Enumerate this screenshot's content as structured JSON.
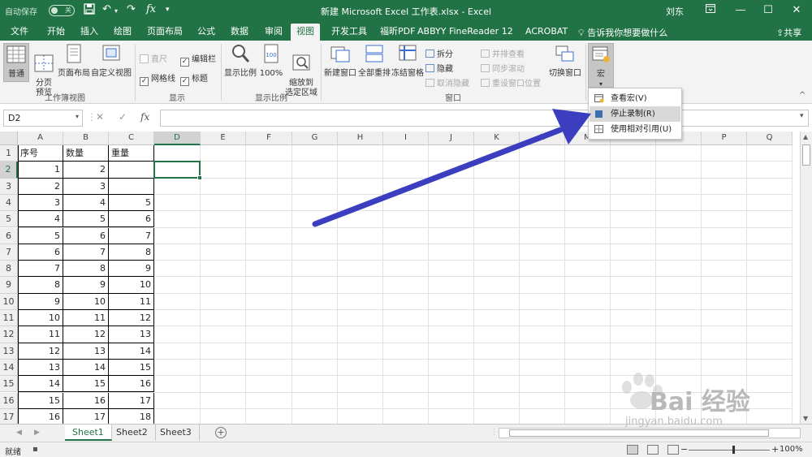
{
  "titlebar": {
    "autosave_label": "自动保存",
    "autosave_state": "关",
    "title": "新建 Microsoft Excel 工作表.xlsx  -  Excel",
    "user": "刘东",
    "undo_icon": "↶",
    "redo_icon": "↷",
    "fx_icon": "fx"
  },
  "tabs": [
    "文件",
    "开始",
    "插入",
    "绘图",
    "页面布局",
    "公式",
    "数据",
    "审阅",
    "视图",
    "开发工具",
    "福昕PDF",
    "ABBYY FineReader 12",
    "ACROBAT"
  ],
  "active_tab": "视图",
  "tellme": "告诉我你想要做什么",
  "share": "共享",
  "ribbon": {
    "group1": {
      "label": "工作簿视图",
      "normal": "普通",
      "pagebreak": "分页\n预览",
      "pagelayout": "页面布局",
      "custom": "自定义视图"
    },
    "group2": {
      "label": "显示",
      "ruler": "直尺",
      "formula_bar": "编辑栏",
      "gridlines": "网格线",
      "headings": "标题"
    },
    "group3": {
      "label": "显示比例",
      "zoom": "显示比例",
      "zoom100": "100%",
      "zoom_sel": "缩放到\n选定区域"
    },
    "group4": {
      "label": "窗口",
      "new_window": "新建窗口",
      "arrange": "全部重排",
      "freeze": "冻结窗格",
      "split": "拆分",
      "hide": "隐藏",
      "unhide": "取消隐藏",
      "side_by_side": "并排查看",
      "sync_scroll": "同步滚动",
      "reset_pos": "重设窗口位置",
      "switch": "切换窗口"
    },
    "group5": {
      "macro": "宏"
    }
  },
  "formula": {
    "namebox": "D2",
    "cancel": "✕",
    "enter": "✓",
    "fx": "fx",
    "value": ""
  },
  "columns": [
    "A",
    "B",
    "C",
    "D",
    "E",
    "F",
    "G",
    "H",
    "I",
    "J",
    "K",
    "L",
    "M",
    "N",
    "O",
    "P",
    "Q"
  ],
  "rows": [
    "1",
    "2",
    "3",
    "4",
    "5",
    "6",
    "7",
    "8",
    "9",
    "10",
    "11",
    "12",
    "13",
    "14",
    "15",
    "16",
    "17"
  ],
  "table": {
    "headers": [
      "序号",
      "数量",
      "重量"
    ],
    "data": [
      [
        "1",
        "2",
        ""
      ],
      [
        "2",
        "3",
        ""
      ],
      [
        "3",
        "4",
        "5"
      ],
      [
        "4",
        "5",
        "6"
      ],
      [
        "5",
        "6",
        "7"
      ],
      [
        "6",
        "7",
        "8"
      ],
      [
        "7",
        "8",
        "9"
      ],
      [
        "8",
        "9",
        "10"
      ],
      [
        "9",
        "10",
        "11"
      ],
      [
        "10",
        "11",
        "12"
      ],
      [
        "11",
        "12",
        "13"
      ],
      [
        "12",
        "13",
        "14"
      ],
      [
        "13",
        "14",
        "15"
      ],
      [
        "14",
        "15",
        "16"
      ],
      [
        "15",
        "16",
        "17"
      ],
      [
        "16",
        "17",
        "18"
      ]
    ]
  },
  "sheets": [
    "Sheet1",
    "Sheet2",
    "Sheet3"
  ],
  "active_sheet": "Sheet1",
  "status": {
    "mode": "就绪",
    "zoom": "100%"
  },
  "macro_menu": {
    "items": [
      "查看宏(V)",
      "停止录制(R)",
      "使用相对引用(U)"
    ],
    "highlighted": 1
  },
  "watermark": {
    "brand": "Bai 经验",
    "url": "jingyan.baidu.com"
  },
  "colors": {
    "excel_green": "#217346",
    "arrow": "#3b3fbf"
  }
}
